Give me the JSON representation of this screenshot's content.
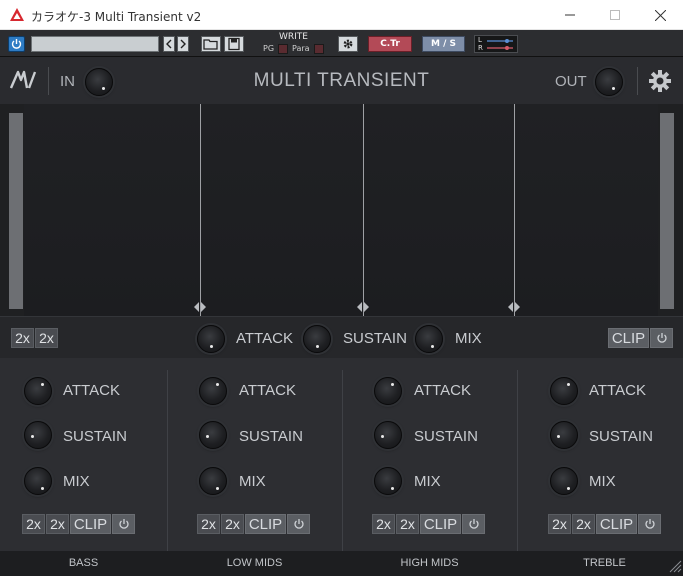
{
  "window": {
    "title": "カラオケ-3 Multi Transient v2"
  },
  "host": {
    "preset_value": "",
    "write_label": "WRITE",
    "pg_label": "PG",
    "para_label": "Para",
    "ctr_label": "C.Tr",
    "ms_label": "M / S",
    "l_label": "L",
    "r_label": "R"
  },
  "plugin": {
    "title": "MULTI TRANSIENT",
    "in_label": "IN",
    "out_label": "OUT"
  },
  "global": {
    "oversample_1": "2x",
    "oversample_2": "2x",
    "attack_label": "ATTACK",
    "sustain_label": "SUSTAIN",
    "mix_label": "MIX",
    "clip_label": "CLIP"
  },
  "bands": [
    {
      "name": "BASS",
      "attack": "ATTACK",
      "sustain": "SUSTAIN",
      "mix": "MIX",
      "os1": "2x",
      "os2": "2x",
      "clip": "CLIP"
    },
    {
      "name": "LOW MIDS",
      "attack": "ATTACK",
      "sustain": "SUSTAIN",
      "mix": "MIX",
      "os1": "2x",
      "os2": "2x",
      "clip": "CLIP"
    },
    {
      "name": "HIGH MIDS",
      "attack": "ATTACK",
      "sustain": "SUSTAIN",
      "mix": "MIX",
      "os1": "2x",
      "os2": "2x",
      "clip": "CLIP"
    },
    {
      "name": "TREBLE",
      "attack": "ATTACK",
      "sustain": "SUSTAIN",
      "mix": "MIX",
      "os1": "2x",
      "os2": "2x",
      "clip": "CLIP"
    }
  ],
  "colors": {
    "accent_blue": "#2e7cc4",
    "ctr_red": "#b34a57",
    "ms_blue": "#7e8ea8",
    "panel": "#2d2e32"
  }
}
